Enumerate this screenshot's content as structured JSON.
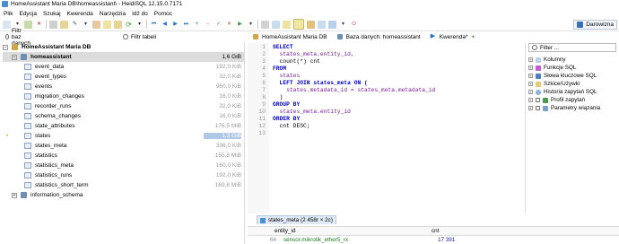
{
  "window": {
    "title": "HomeAssistant Maria DB\\homeassistant\\ - HeidiSQL 12.15.0.7171"
  },
  "menu": [
    "Plik",
    "Edycja",
    "Szukaj",
    "Kwerenda",
    "Narzędzia",
    "Idź do",
    "Pomoc"
  ],
  "toolbar": {
    "donate_label": "Darowizna"
  },
  "filters": {
    "databases_placeholder": "Filtr baz danych",
    "tables_placeholder": "Filtr tabeli"
  },
  "tabs": [
    {
      "label": "HomeAssistant Maria DB"
    },
    {
      "label": "Baza danych: homeassistant"
    },
    {
      "label": "Kwerenda*"
    }
  ],
  "tree": {
    "server": "HomeAssistant Maria DB",
    "database": {
      "name": "homeassistant",
      "size": "1,6 GiB"
    },
    "tables": [
      {
        "name": "event_data",
        "size": "192,0 KiB"
      },
      {
        "name": "event_types",
        "size": "32,0 KiB"
      },
      {
        "name": "events",
        "size": "960,0 KiB"
      },
      {
        "name": "migration_changes",
        "size": "16,0 KiB"
      },
      {
        "name": "recorder_runs",
        "size": "32,0 KiB"
      },
      {
        "name": "schema_changes",
        "size": "16,0 KiB"
      },
      {
        "name": "state_attributes",
        "size": "176,5 MiB"
      },
      {
        "name": "states",
        "size": "1,3 GiB"
      },
      {
        "name": "states_meta",
        "size": "336,0 KiB"
      },
      {
        "name": "statistics",
        "size": "155,8 MiB"
      },
      {
        "name": "statistics_meta",
        "size": "160,0 KiB"
      },
      {
        "name": "statistics_runs",
        "size": "192,0 KiB"
      },
      {
        "name": "statistics_short_term",
        "size": "169,6 MiB"
      }
    ],
    "other_database": "information_schema"
  },
  "editor": {
    "lines": [
      "SELECT",
      "  states_meta.entity_id,",
      "  count(*) cnt",
      "FROM",
      "  states",
      "  LEFT JOIN states_meta ON (",
      "    states.metadata_id = states_meta.metadata_id",
      "  )",
      "GROUP BY",
      "  states_meta.entity_id",
      "ORDER BY",
      "  cnt DESC;",
      ""
    ],
    "line_numbers": [
      "1",
      "2",
      "3",
      "4",
      "5",
      "6",
      "7",
      "8",
      "9",
      "10",
      "11",
      "12",
      "13"
    ]
  },
  "helpers": {
    "filter_placeholder": "Filter ...",
    "items": [
      "Kolumny",
      "Funkcje SQL",
      "Słowa kluczowe SQL",
      "Szkice/Używki",
      "Historia zapytań SQL",
      "Profil zapytań",
      "Parametry wiązania"
    ]
  },
  "results": {
    "tab_label": "states_meta (2 458r × 2c)",
    "columns": [
      "entity_id",
      "cnt"
    ],
    "rows": [
      {
        "num": "64",
        "entity_id": "sensor.mikrotik_ether5_rx",
        "cnt": "17 391"
      }
    ]
  },
  "colors": {
    "selection": "#dcdcdc",
    "keyword": "#0000c8",
    "identifier": "#7a1a9a"
  }
}
